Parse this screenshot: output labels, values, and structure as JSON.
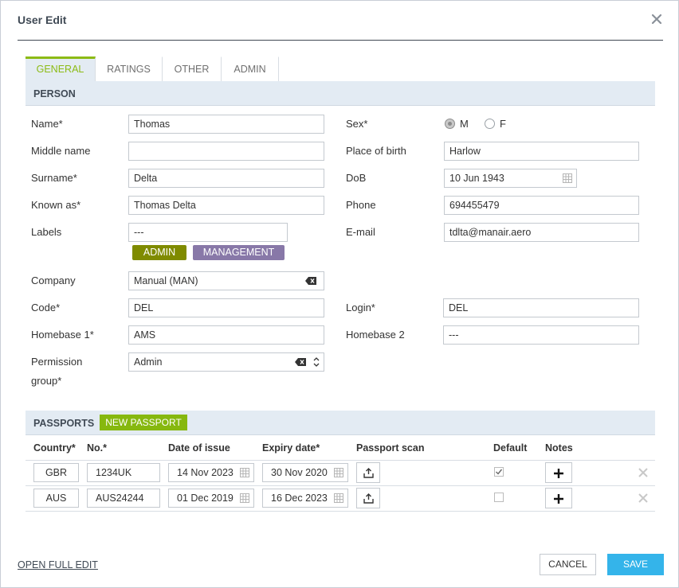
{
  "dialog": {
    "title": "User Edit"
  },
  "tabs": [
    {
      "label": "GENERAL",
      "active": true
    },
    {
      "label": "RATINGS"
    },
    {
      "label": "OTHER"
    },
    {
      "label": "ADMIN"
    }
  ],
  "person": {
    "section_title": "PERSON",
    "name_label": "Name*",
    "name_value": "Thomas",
    "middle_label": "Middle name",
    "middle_value": "",
    "surname_label": "Surname*",
    "surname_value": "Delta",
    "known_label": "Known as*",
    "known_value": "Thomas Delta",
    "labels_label": "Labels",
    "labels_value": "---",
    "tags": [
      {
        "text": "ADMIN",
        "color": "#7f8b00"
      },
      {
        "text": "MANAGEMENT",
        "color": "#8878a8"
      }
    ],
    "company_label": "Company",
    "company_value": "Manual (MAN)",
    "code_label": "Code*",
    "code_value": "DEL",
    "homebase1_label": "Homebase 1*",
    "homebase1_value": "AMS",
    "permission_label_1": "Permission",
    "permission_label_2": "group*",
    "permission_value": "Admin",
    "sex_label": "Sex*",
    "sex_m": "M",
    "sex_f": "F",
    "sex_selected": "M",
    "pob_label": "Place of birth",
    "pob_value": "Harlow",
    "dob_label": "DoB",
    "dob_value": "10 Jun 1943",
    "phone_label": "Phone",
    "phone_value": "694455479",
    "email_label": "E-mail",
    "email_value": "tdlta@manair.aero",
    "login_label": "Login*",
    "login_value": "DEL",
    "homebase2_label": "Homebase 2",
    "homebase2_value": "---"
  },
  "passports": {
    "section_title": "PASSPORTS",
    "new_button": "NEW PASSPORT",
    "columns": [
      "Country*",
      "No.*",
      "Date of issue",
      "Expiry date*",
      "Passport scan",
      "Default",
      "Notes"
    ],
    "rows": [
      {
        "country": "GBR",
        "number": "1234UK",
        "issue": "14 Nov 2023",
        "expiry": "30 Nov 2020",
        "default": true
      },
      {
        "country": "AUS",
        "number": "AUS24244",
        "issue": "01 Dec 2019",
        "expiry": "16 Dec 2023",
        "default": false
      }
    ]
  },
  "footer": {
    "open_full_edit": "OPEN FULL EDIT",
    "cancel": "CANCEL",
    "save": "SAVE"
  },
  "colors": {
    "accent_green": "#86b80f",
    "save_blue": "#34b4ea",
    "section_bg": "#e3ebf3"
  }
}
